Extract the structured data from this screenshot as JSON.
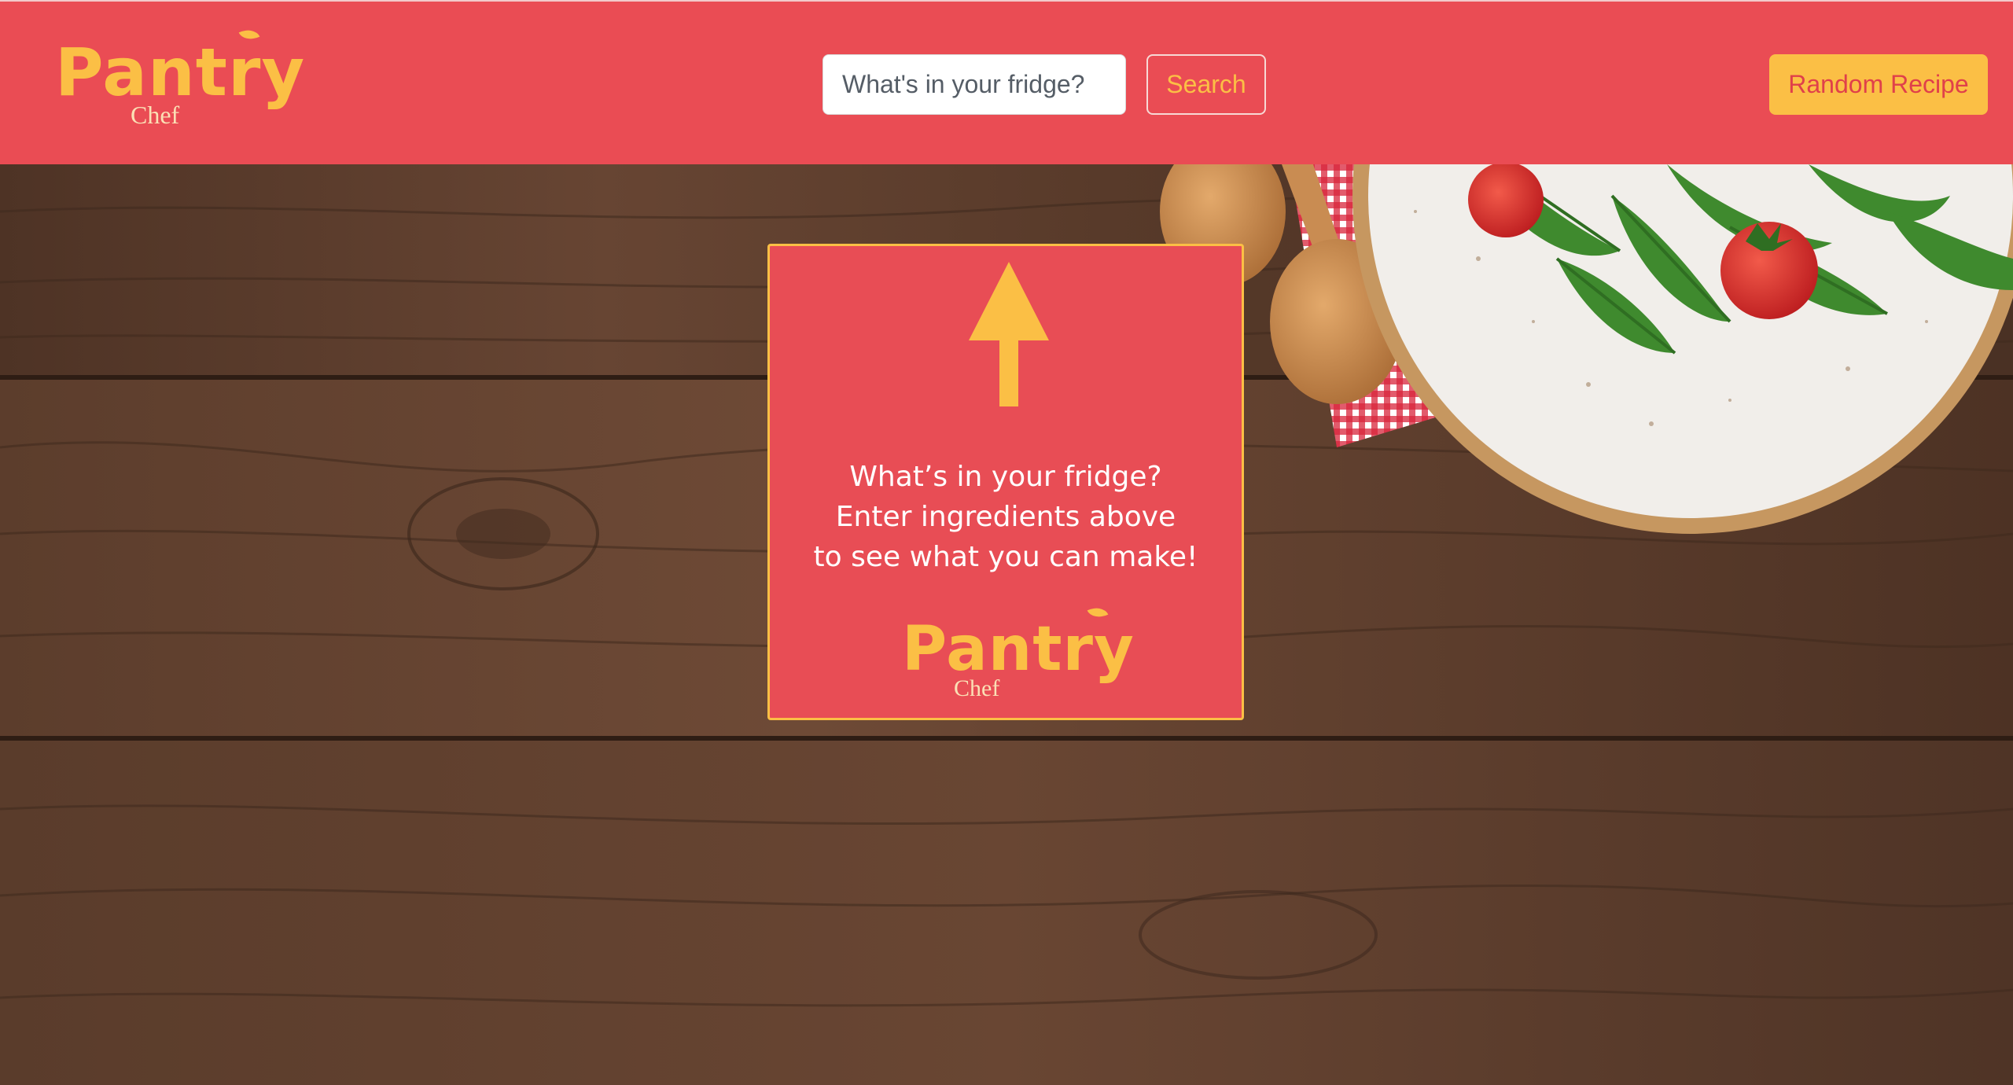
{
  "navbar": {
    "brand": {
      "name": "Pantry",
      "sub": "Chef"
    },
    "search": {
      "placeholder": "What's in your fridge?",
      "button_label": "Search"
    },
    "random_label": "Random Recipe",
    "colors": {
      "background": "#ea4c54",
      "accent": "#fbbf45"
    }
  },
  "background": {
    "description_icon": "wooden-table-with-salad-plate"
  },
  "card": {
    "message_lines": [
      "What’s in your fridge?",
      "Enter ingredients above",
      "to see what you can make!"
    ],
    "brand": {
      "name": "Pantry",
      "sub": "Chef"
    },
    "icon": "arrow-up-icon"
  }
}
